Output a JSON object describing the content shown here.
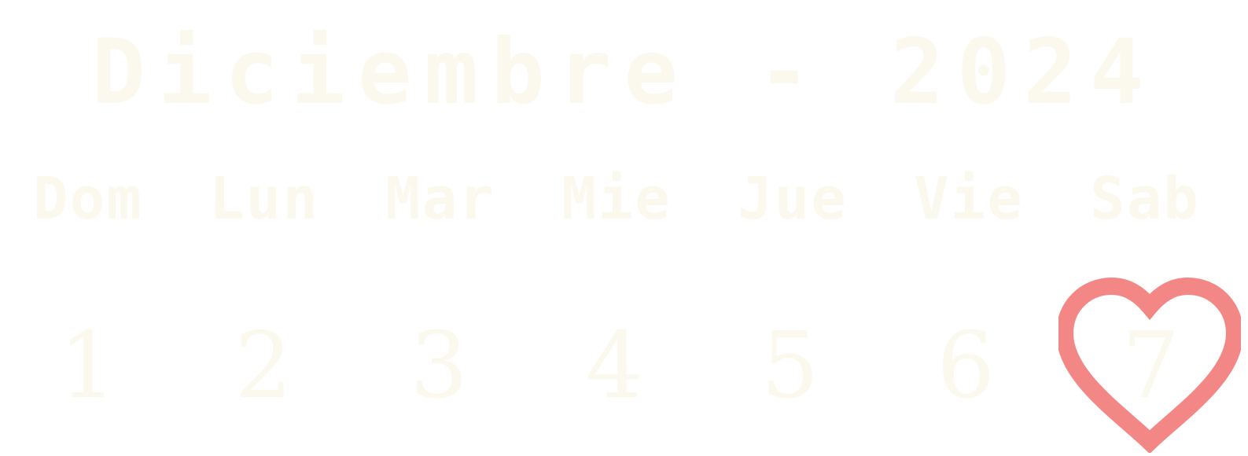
{
  "calendar": {
    "title": "Diciembre - 2024",
    "weekdays": [
      "Dom",
      "Lun",
      "Mar",
      "Mie",
      "Jue",
      "Vie",
      "Sab"
    ],
    "days": [
      "1",
      "2",
      "3",
      "4",
      "5",
      "6",
      "7"
    ],
    "highlighted_day": "7",
    "highlight_icon": "heart-icon",
    "colors": {
      "text": "#fbf8ee",
      "heart": "#f28786",
      "background": "#ffffff"
    }
  }
}
